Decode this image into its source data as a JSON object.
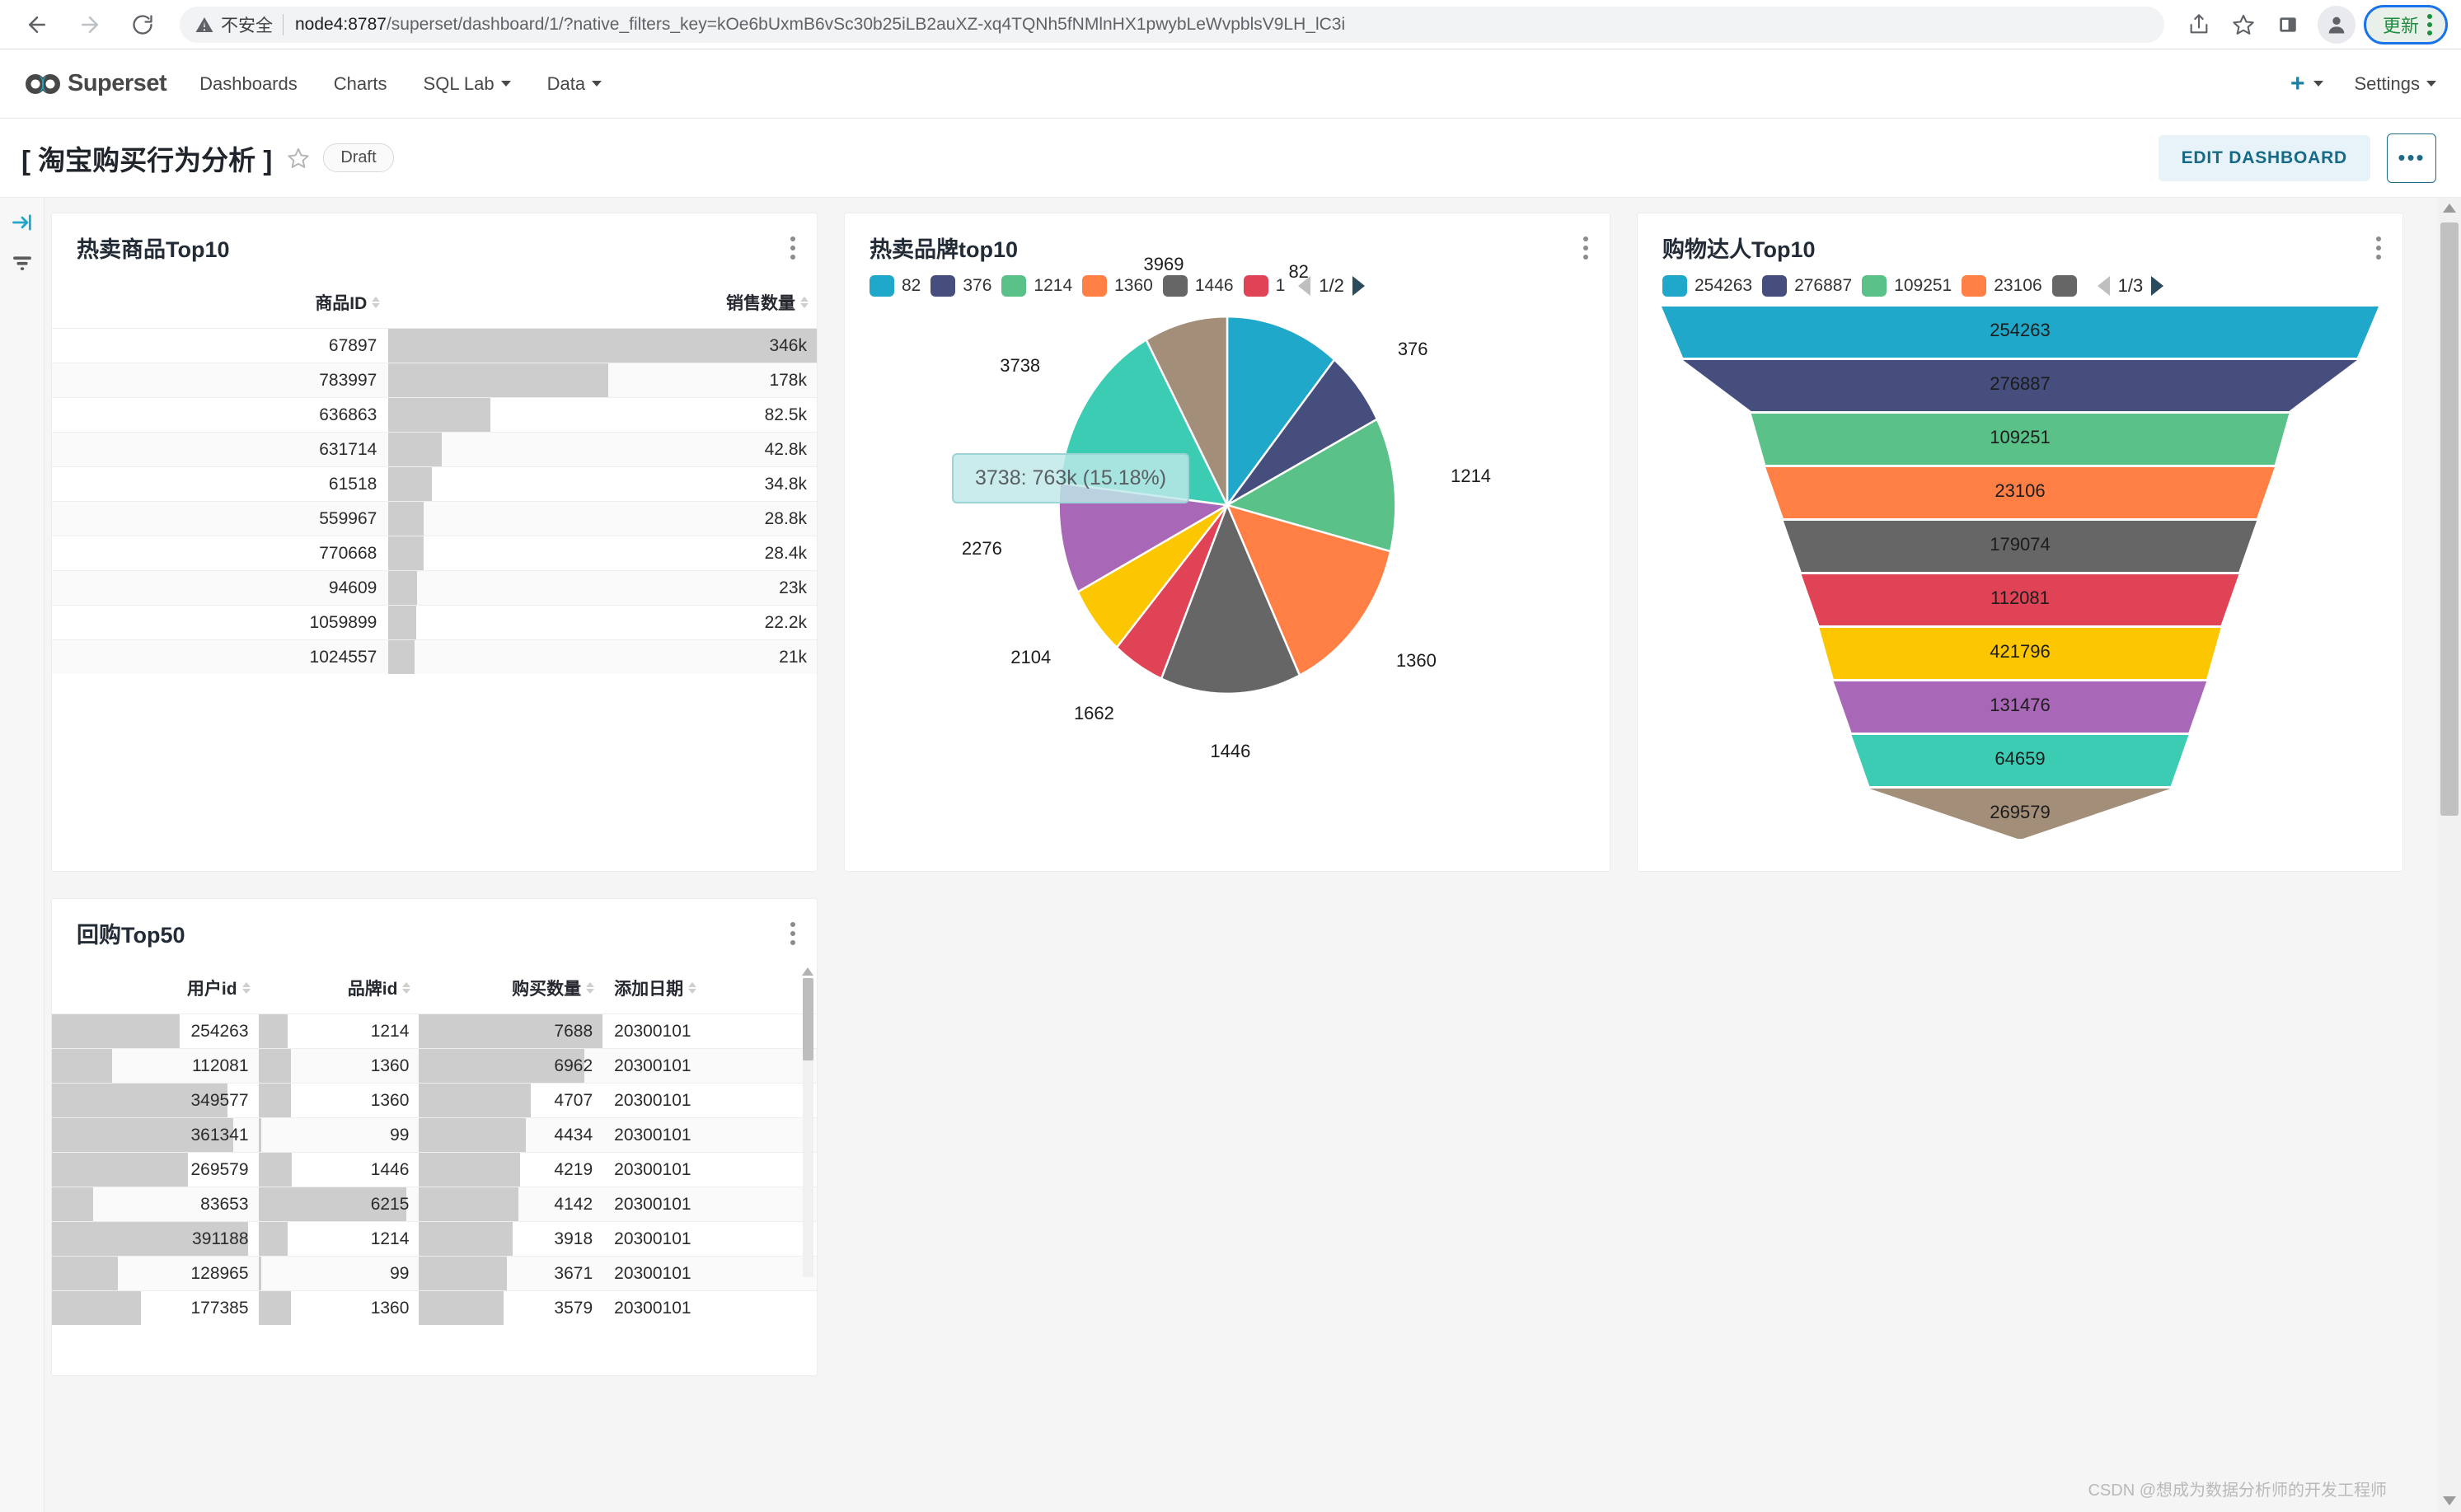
{
  "browser": {
    "back_icon": "arrow-left-icon",
    "forward_icon": "arrow-right-icon",
    "reload_icon": "reload-icon",
    "security_label": "不安全",
    "url_host": "node4:8787",
    "url_path": "/superset/dashboard/1/?native_filters_key=kOe6bUxmB6vSc30b25iLB2auXZ-xq4TQNh5fNMlnHX1pwybLeWvpblsV9LH_lC3i",
    "share_icon": "share-icon",
    "bookmark_icon": "star-icon",
    "sidepanel_icon": "side-panel-icon",
    "profile_icon": "profile-avatar-icon",
    "update_label": "更新",
    "update_menu_icon": "kebab-menu-icon",
    "accent_focus": "#1a73e8",
    "update_text_color": "#1e8e3e"
  },
  "navbar": {
    "brand": "Superset",
    "links": [
      {
        "label": "Dashboards",
        "has_caret": false
      },
      {
        "label": "Charts",
        "has_caret": false
      },
      {
        "label": "SQL Lab",
        "has_caret": true
      },
      {
        "label": "Data",
        "has_caret": true
      }
    ],
    "plus_label": "+",
    "settings_label": "Settings"
  },
  "dashboard_header": {
    "title": "[ 淘宝购买行为分析 ]",
    "favorite_icon": "star-outline-icon",
    "status_badge": "Draft",
    "edit_label": "EDIT DASHBOARD",
    "more_label": "•••"
  },
  "filter_rail": {
    "expand_icon": "expand-filter-bar-icon",
    "filter_icon": "filter-icon"
  },
  "watermark": "CSDN @想成为数据分析师的开发工程师",
  "chart_data": [
    {
      "id": "hot-products",
      "type": "table",
      "title": "热卖商品Top10",
      "columns": [
        "商品ID",
        "销售数量"
      ],
      "rows": [
        {
          "商品ID": "67897",
          "销售数量": "346k",
          "bar_pct": 100.0
        },
        {
          "商品ID": "783997",
          "销售数量": "178k",
          "bar_pct": 51.4
        },
        {
          "商品ID": "636863",
          "销售数量": "82.5k",
          "bar_pct": 23.8
        },
        {
          "商品ID": "631714",
          "销售数量": "42.8k",
          "bar_pct": 12.4
        },
        {
          "商品ID": "61518",
          "销售数量": "34.8k",
          "bar_pct": 10.1
        },
        {
          "商品ID": "559967",
          "销售数量": "28.8k",
          "bar_pct": 8.3
        },
        {
          "商品ID": "770668",
          "销售数量": "28.4k",
          "bar_pct": 8.2
        },
        {
          "商品ID": "94609",
          "销售数量": "23k",
          "bar_pct": 6.6
        },
        {
          "商品ID": "1059899",
          "销售数量": "22.2k",
          "bar_pct": 6.4
        },
        {
          "商品ID": "1024557",
          "销售数量": "21k",
          "bar_pct": 6.1
        }
      ],
      "bar_color": "#cdcdcd"
    },
    {
      "id": "hot-brands",
      "type": "pie",
      "title": "热卖品牌top10",
      "legend_page": "1/2",
      "legend": [
        {
          "label": "82",
          "color": "#1fa8c9"
        },
        {
          "label": "376",
          "color": "#454e7c"
        },
        {
          "label": "1214",
          "color": "#5ac189"
        },
        {
          "label": "1360",
          "color": "#ff7f44"
        },
        {
          "label": "1446",
          "color": "#666666"
        },
        {
          "label": "1",
          "color": "#e04355"
        }
      ],
      "categories": [
        "82",
        "376",
        "1214",
        "1360",
        "1446",
        "1662",
        "2104",
        "2276",
        "3738",
        "3969"
      ],
      "colors": [
        "#1fa8c9",
        "#454e7c",
        "#5ac189",
        "#ff7f44",
        "#666666",
        "#e04355",
        "#fcc700",
        "#a868b7",
        "#3cccb4",
        "#a38f79"
      ],
      "values": [
        11.0,
        6.5,
        11.5,
        14.0,
        13.5,
        5.0,
        6.0,
        9.5,
        15.18,
        8.0
      ],
      "tooltip": "3738: 763k (15.18%)",
      "tooltip_series": "3738",
      "tooltip_value": "763k",
      "tooltip_pct": "15.18%"
    },
    {
      "id": "shopping-experts",
      "type": "funnel",
      "title": "购物达人Top10",
      "legend_page": "1/3",
      "legend": [
        {
          "label": "254263",
          "color": "#1fa8c9"
        },
        {
          "label": "276887",
          "color": "#454e7c"
        },
        {
          "label": "109251",
          "color": "#5ac189"
        },
        {
          "label": "23106",
          "color": "#ff7f44"
        },
        {
          "label": "",
          "color": "#666666"
        }
      ],
      "categories": [
        "254263",
        "276887",
        "109251",
        "23106",
        "179074",
        "112081",
        "421796",
        "131476",
        "64659",
        "269579"
      ],
      "colors": [
        "#1fa8c9",
        "#454e7c",
        "#5ac189",
        "#ff7f44",
        "#666666",
        "#e04355",
        "#fcc700",
        "#a868b7",
        "#3cccb4",
        "#a38f79"
      ],
      "widths": [
        100,
        94,
        75,
        71,
        66,
        61,
        56,
        52,
        47,
        42
      ]
    },
    {
      "id": "repurchase-top50",
      "type": "table",
      "title": "回购Top50",
      "columns": [
        "用户id",
        "品牌id",
        "购买数量",
        "添加日期"
      ],
      "rows": [
        {
          "用户id": "254263",
          "品牌id": "1214",
          "购买数量": "7688",
          "添加日期": "20300101",
          "u_bar": 62,
          "b_bar": 18,
          "q_bar": 100
        },
        {
          "用户id": "112081",
          "品牌id": "1360",
          "购买数量": "6962",
          "添加日期": "20300101",
          "u_bar": 29,
          "b_bar": 20,
          "q_bar": 90
        },
        {
          "用户id": "349577",
          "品牌id": "1360",
          "购买数量": "4707",
          "添加日期": "20300101",
          "u_bar": 85,
          "b_bar": 20,
          "q_bar": 61
        },
        {
          "用户id": "361341",
          "品牌id": "99",
          "购买数量": "4434",
          "添加日期": "20300101",
          "u_bar": 88,
          "b_bar": 2,
          "q_bar": 58
        },
        {
          "用户id": "269579",
          "品牌id": "1446",
          "购买数量": "4219",
          "添加日期": "20300101",
          "u_bar": 66,
          "b_bar": 21,
          "q_bar": 55
        },
        {
          "用户id": "83653",
          "品牌id": "6215",
          "购买数量": "4142",
          "添加日期": "20300101",
          "u_bar": 20,
          "b_bar": 92,
          "q_bar": 54
        },
        {
          "用户id": "391188",
          "品牌id": "1214",
          "购买数量": "3918",
          "添加日期": "20300101",
          "u_bar": 95,
          "b_bar": 18,
          "q_bar": 51
        },
        {
          "用户id": "128965",
          "品牌id": "99",
          "购买数量": "3671",
          "添加日期": "20300101",
          "u_bar": 32,
          "b_bar": 2,
          "q_bar": 48
        },
        {
          "用户id": "177385",
          "品牌id": "1360",
          "购买数量": "3579",
          "添加日期": "20300101",
          "u_bar": 43,
          "b_bar": 20,
          "q_bar": 46
        }
      ],
      "bar_color": "#cdcdcd"
    }
  ]
}
